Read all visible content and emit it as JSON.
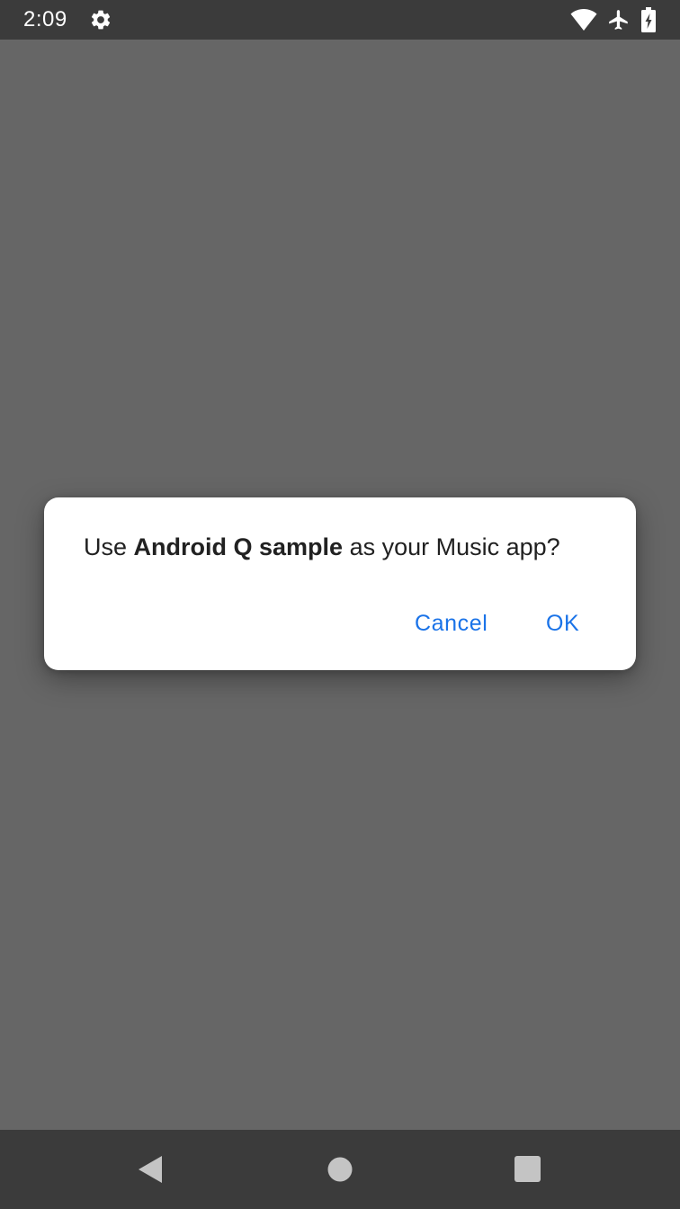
{
  "status_bar": {
    "time": "2:09",
    "icons": [
      "gear-icon",
      "wifi-icon",
      "airplane-icon",
      "battery-charging-icon"
    ]
  },
  "dialog": {
    "message_prefix": "Use ",
    "app_name": "Android Q sample",
    "message_suffix": " as your Music app?",
    "cancel_label": "Cancel",
    "ok_label": "OK"
  },
  "nav_bar": {
    "icons": [
      "back-icon",
      "home-icon",
      "recents-icon"
    ]
  },
  "colors": {
    "scrim": "#666666",
    "system_bars": "#3b3b3b",
    "dialog_bg": "#ffffff",
    "button_text": "#1a73e8",
    "message_text": "#212121"
  }
}
